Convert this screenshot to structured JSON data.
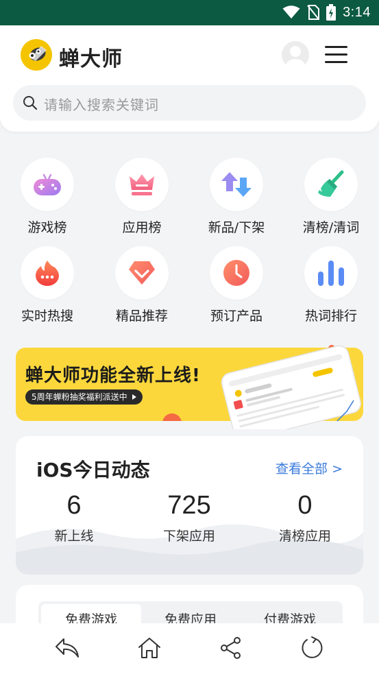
{
  "status_bar": {
    "time": "3:14"
  },
  "header": {
    "brand": "蝉大师",
    "search_placeholder": "请输入搜索关键词"
  },
  "quick_links": [
    {
      "label": "游戏榜",
      "icon": "gamepad-icon"
    },
    {
      "label": "应用榜",
      "icon": "crown-icon"
    },
    {
      "label": "新品/下架",
      "icon": "up-down-arrows-icon"
    },
    {
      "label": "清榜/清词",
      "icon": "broom-icon"
    },
    {
      "label": "实时热搜",
      "icon": "fire-icon"
    },
    {
      "label": "精品推荐",
      "icon": "diamond-icon"
    },
    {
      "label": "预订产品",
      "icon": "clock-icon"
    },
    {
      "label": "热词排行",
      "icon": "bar-chart-icon"
    }
  ],
  "banner": {
    "title": "蝉大师功能全新上线!",
    "subtitle": "5周年蝉粉抽奖福利派送中"
  },
  "ios_today": {
    "title": "iOS今日动态",
    "view_all": "查看全部 >",
    "stats": [
      {
        "value": "6",
        "label": "新上线"
      },
      {
        "value": "725",
        "label": "下架应用"
      },
      {
        "value": "0",
        "label": "清榜应用"
      }
    ]
  },
  "rank_tabs": {
    "tabs": [
      "免费游戏",
      "免费应用",
      "付费游戏"
    ],
    "active_index": 0
  },
  "bottom_nav": [
    "back-icon",
    "home-icon",
    "share-icon",
    "refresh-icon"
  ],
  "colors": {
    "status_bar": "#0c5a41",
    "accent_link": "#3a7bdc",
    "banner_bg": "#fcd73c"
  }
}
